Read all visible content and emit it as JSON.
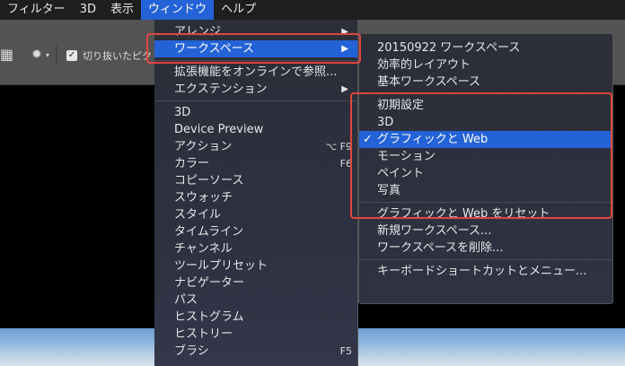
{
  "menubar": [
    {
      "label": "フィルター",
      "active": false
    },
    {
      "label": "3D",
      "active": false
    },
    {
      "label": "表示",
      "active": false
    },
    {
      "label": "ウィンドウ",
      "active": true
    },
    {
      "label": "ヘルプ",
      "active": false
    }
  ],
  "options": {
    "checkbox_label": "切り抜いたピク",
    "checkbox_checked": true
  },
  "window_menu": [
    {
      "label": "アレンジ",
      "submenu": true
    },
    {
      "label": "ワークスペース",
      "submenu": true,
      "highlighted": true
    },
    {
      "sep": true
    },
    {
      "label": "拡張機能をオンラインで参照..."
    },
    {
      "label": "エクステンション",
      "submenu": true
    },
    {
      "sep": true
    },
    {
      "label": "3D"
    },
    {
      "label": "Device Preview"
    },
    {
      "label": "アクション",
      "shortcut": "⌥ F9"
    },
    {
      "label": "カラー",
      "shortcut": "F6"
    },
    {
      "label": "コピーソース"
    },
    {
      "label": "スウォッチ"
    },
    {
      "label": "スタイル"
    },
    {
      "label": "タイムライン"
    },
    {
      "label": "チャンネル"
    },
    {
      "label": "ツールプリセット"
    },
    {
      "label": "ナビゲーター"
    },
    {
      "label": "パス"
    },
    {
      "label": "ヒストグラム"
    },
    {
      "label": "ヒストリー"
    },
    {
      "label": "ブラシ",
      "shortcut": "F5"
    }
  ],
  "workspace_submenu": [
    {
      "label": "20150922 ワークスペース"
    },
    {
      "label": "効率的レイアウト"
    },
    {
      "label": "基本ワークスペース"
    },
    {
      "sep": true
    },
    {
      "label": "初期設定"
    },
    {
      "label": "3D"
    },
    {
      "label": "グラフィックと Web",
      "checked": true,
      "highlighted": true
    },
    {
      "label": "モーション"
    },
    {
      "label": "ペイント"
    },
    {
      "label": "写真"
    },
    {
      "sep": true
    },
    {
      "label": "グラフィックと Web をリセット"
    },
    {
      "label": "新規ワークスペース..."
    },
    {
      "label": "ワークスペースを削除..."
    },
    {
      "sep": true
    },
    {
      "label": "キーボードショートカットとメニュー..."
    }
  ],
  "colors": {
    "accent": "#2462d8",
    "highlight_box": "#e0463f"
  },
  "icons": {
    "grid": "grid-icon",
    "gear": "gear-icon",
    "checkmark": "checkmark-icon",
    "submenu_arrow": "triangle-right-icon"
  }
}
